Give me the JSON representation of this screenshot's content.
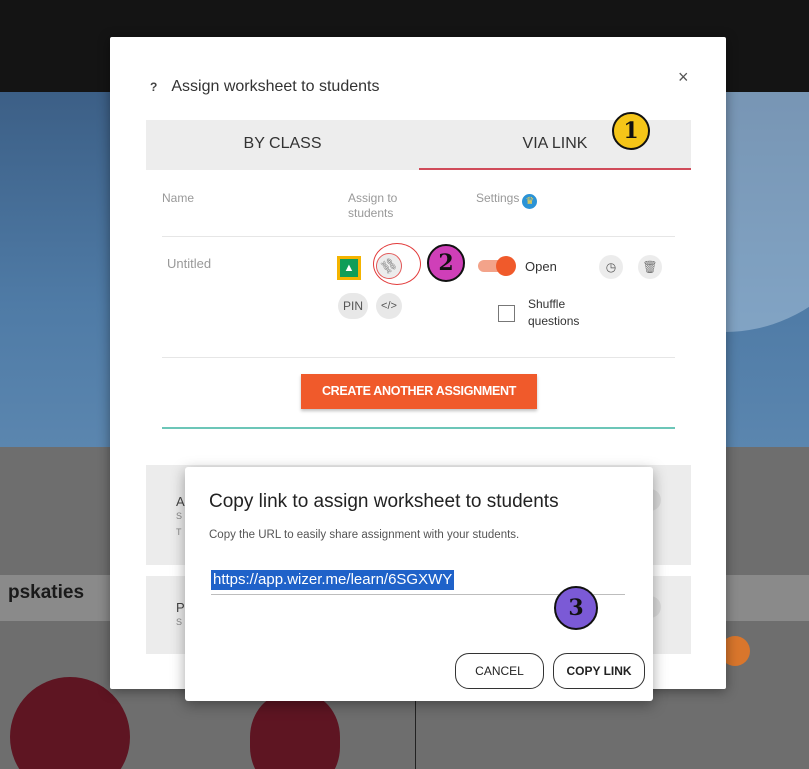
{
  "modal": {
    "title": "Assign worksheet to students",
    "help_icon": "?",
    "close_icon": "×",
    "tabs": [
      {
        "label": "BY CLASS"
      },
      {
        "label": "VIA LINK"
      }
    ],
    "columns": {
      "name": "Name",
      "assign": "Assign to students",
      "settings": "Settings"
    },
    "row": {
      "name": "Untitled",
      "pin": "PIN",
      "embed": "</>",
      "toggle_label": "Open",
      "shuffle_label": "Shuffle questions"
    },
    "create_button": "CREATE ANOTHER ASSIGNMENT",
    "card_letters": [
      "A",
      "P"
    ],
    "card_smalls": [
      "S",
      "T",
      "S"
    ]
  },
  "dialog": {
    "title": "Copy link to assign worksheet to students",
    "subtitle": "Copy the URL to easily share assignment with your students.",
    "url": "https://app.wizer.me/learn/6SGXWY",
    "cancel": "CANCEL",
    "copy": "COPY LINK"
  },
  "background": {
    "text": "pskaties"
  },
  "annotations": [
    "1",
    "2",
    "3"
  ],
  "colors": {
    "accent_orange": "#f05a2b",
    "tab_underline": "#d04b5a",
    "teal": "#6cc6b8",
    "url_highlight": "#1f62c9"
  }
}
